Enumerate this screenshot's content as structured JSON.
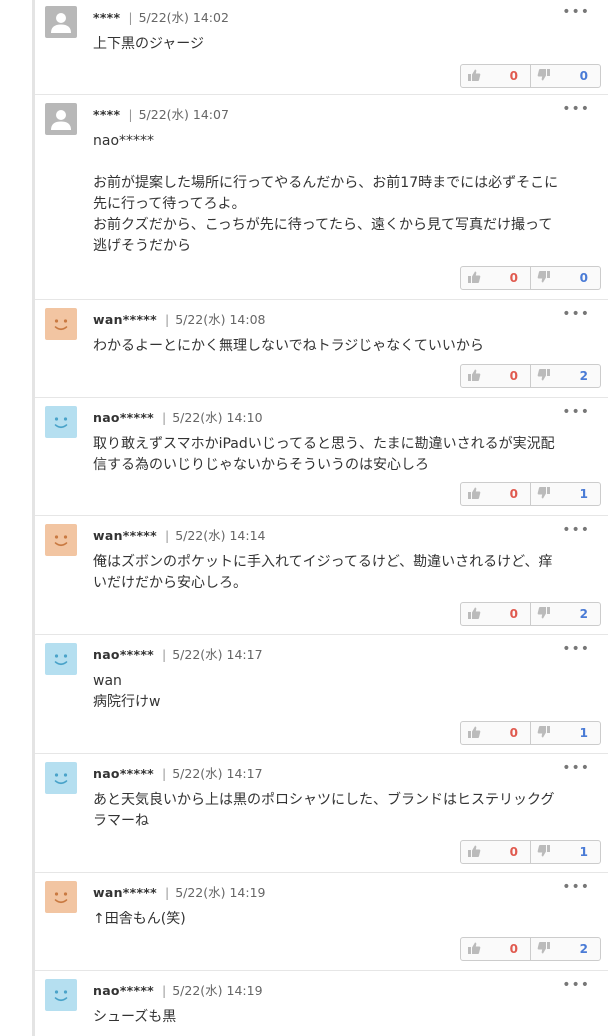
{
  "icons": {
    "thumbs_up": "thumbs-up-icon",
    "thumbs_down": "thumbs-down-icon",
    "more": "more-icon"
  },
  "colors": {
    "up": "#e05a4f",
    "down": "#4a7bd6",
    "orange_avatar": "#f2c5a2",
    "blue_avatar": "#b5dff0",
    "gray_avatar": "#b8b8b8"
  },
  "comments": [
    {
      "user": "****",
      "sep": "|",
      "time": "5/22(水) 14:02",
      "text": "上下黒のジャージ",
      "up": "0",
      "down": "0",
      "avatar": "gray"
    },
    {
      "user": "****",
      "sep": "|",
      "time": "5/22(水) 14:07",
      "text": "nao*****\n\nお前が提案した場所に行ってやるんだから、お前17時までには必ずそこに\n先に行って待ってろよ。\nお前クズだから、こっちが先に待ってたら、遠くから見て写真だけ撮って\n逃げそうだから",
      "up": "0",
      "down": "0",
      "avatar": "gray"
    },
    {
      "user": "wan*****",
      "sep": "|",
      "time": "5/22(水) 14:08",
      "text": "わかるよーとにかく無理しないでねトラジじゃなくていいから",
      "up": "0",
      "down": "2",
      "avatar": "orange"
    },
    {
      "user": "nao*****",
      "sep": "|",
      "time": "5/22(水) 14:10",
      "text": "取り敢えずスマホかiPadいじってると思う、たまに勘違いされるが実況配\n信する為のいじりじゃないからそういうのは安心しろ",
      "up": "0",
      "down": "1",
      "avatar": "blue"
    },
    {
      "user": "wan*****",
      "sep": "|",
      "time": "5/22(水) 14:14",
      "text": "俺はズボンのポケットに手入れてイジってるけど、勘違いされるけど、痒\nいだけだから安心しろ。",
      "up": "0",
      "down": "2",
      "avatar": "orange"
    },
    {
      "user": "nao*****",
      "sep": "|",
      "time": "5/22(水) 14:17",
      "text": "wan\n病院行けw",
      "up": "0",
      "down": "1",
      "avatar": "blue"
    },
    {
      "user": "nao*****",
      "sep": "|",
      "time": "5/22(水) 14:17",
      "text": "あと天気良いから上は黒のポロシャツにした、ブランドはヒステリックグ\nラマーね",
      "up": "0",
      "down": "1",
      "avatar": "blue"
    },
    {
      "user": "wan*****",
      "sep": "|",
      "time": "5/22(水) 14:19",
      "text": "↑田舎もん(笑)",
      "up": "0",
      "down": "2",
      "avatar": "orange"
    },
    {
      "user": "nao*****",
      "sep": "|",
      "time": "5/22(水) 14:19",
      "text": "シューズも黒",
      "up": "",
      "down": "",
      "avatar": "blue"
    }
  ]
}
